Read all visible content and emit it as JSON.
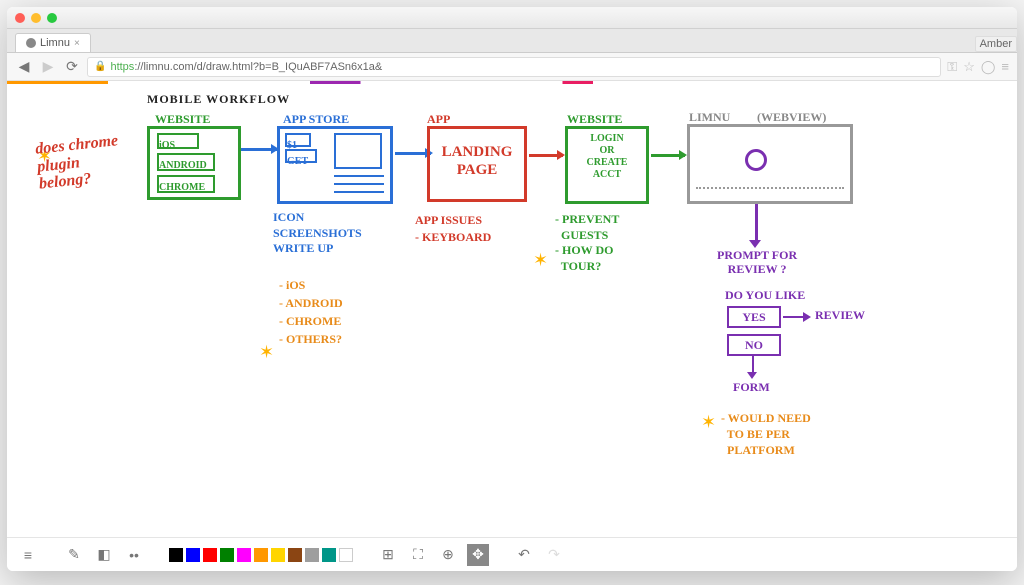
{
  "browser": {
    "tab_title": "Limnu",
    "user": "Amber",
    "url_https": "https",
    "url_rest": "://limnu.com/d/draw.html?b=B_IQuABF7ASn6x1a&"
  },
  "title": "MOBILE WORKFLOW",
  "aside": "does chrome plugin belong?",
  "nodes": {
    "website": {
      "label": "WEBSITE",
      "items": [
        "iOS",
        "ANDROID",
        "CHROME"
      ]
    },
    "appstore": {
      "label": "APP STORE",
      "btn1": "$1",
      "btn2": "GET",
      "notes": "ICON\nSCREENSHOTS\nWRITE UP",
      "platforms": [
        "- iOS",
        "- ANDROID",
        "- CHROME",
        "- OTHERS?"
      ]
    },
    "app": {
      "label": "APP",
      "box": "LANDING\nPAGE",
      "notes": "APP ISSUES\n- KEYBOARD"
    },
    "website2": {
      "label": "WEBSITE",
      "box": "LOGIN\nOR\nCREATE\nACCT",
      "notes": "- PREVENT\n  GUESTS\n- HOW DO\n  TOUR?"
    },
    "limnu": {
      "label": "LIMNU",
      "sub": "(WEBVIEW)"
    },
    "review": {
      "prompt": "PROMPT FOR\nREVIEW ?",
      "question": "DO YOU LIKE",
      "yes": "YES",
      "no": "NO",
      "review_label": "REVIEW",
      "form": "FORM",
      "footnote": "- WOULD NEED\n  TO BE PER\n  PLATFORM"
    }
  },
  "toolbar": {
    "swatches": [
      "#000000",
      "#0000ff",
      "#ff0000",
      "#008000",
      "#ff00ff",
      "#ff9800",
      "#ffd500",
      "#8b4513",
      "#9e9e9e",
      "#009688"
    ]
  }
}
